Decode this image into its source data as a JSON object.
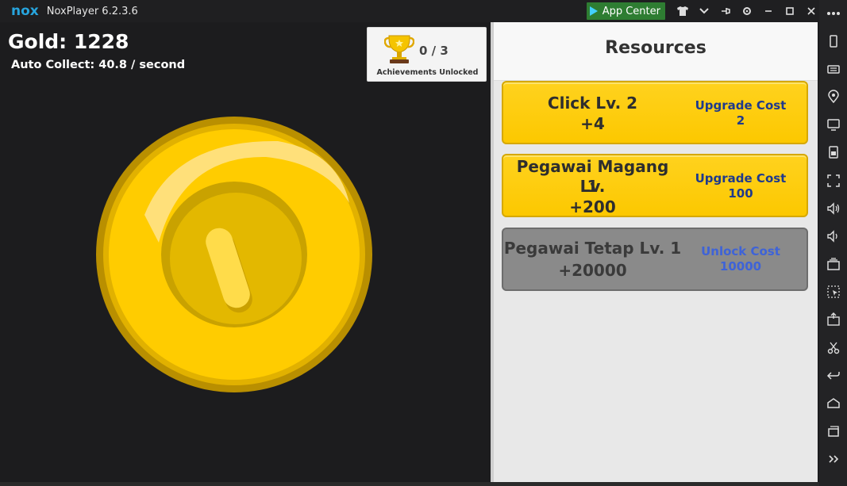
{
  "window": {
    "logo": "nox",
    "title": "NoxPlayer 6.2.3.6",
    "app_center_label": "App Center",
    "controls": [
      "shirt-icon",
      "chevron-down-icon",
      "pin-icon",
      "gear-icon",
      "minimize-icon",
      "maximize-icon",
      "close-icon"
    ]
  },
  "sidebar": {
    "items": [
      "more-icon",
      "phone-rotate-icon",
      "keyboard-icon",
      "location-icon",
      "screen-icon",
      "backup-icon",
      "fullscreen-icon",
      "volume-up-icon",
      "volume-down-icon",
      "multi-instance-icon",
      "macro-icon",
      "apk-install-icon",
      "scissors-icon",
      "back-icon",
      "home-icon",
      "recent-apps-icon",
      "expand-icon"
    ]
  },
  "game": {
    "gold_text": "Gold: 1228",
    "auto_collect_text": "Auto Collect: 40.8 / second",
    "achievements": {
      "count": "0 / 3",
      "label": "Achievements Unlocked"
    }
  },
  "resources": {
    "title": "Resources",
    "items": [
      {
        "name": "Click Lv. 2",
        "gain": "+4",
        "cost_label": "Upgrade Cost",
        "cost": "2",
        "state": "unlocked"
      },
      {
        "name": "Pegawai Magang Lv.",
        "name2": "1",
        "gain": "+200",
        "cost_label": "Upgrade Cost",
        "cost": "100",
        "state": "unlocked"
      },
      {
        "name": "Pegawai Tetap Lv. 1",
        "gain": "+20000",
        "cost_label": "Unlock Cost",
        "cost": "10000",
        "state": "locked"
      }
    ]
  },
  "colors": {
    "accent_yellow": "#fcc800",
    "locked_gray": "#8a8a8a",
    "cost_blue": "#1f3a8c",
    "nox_blue": "#27a4dd",
    "app_center_green": "#2e7d32"
  }
}
